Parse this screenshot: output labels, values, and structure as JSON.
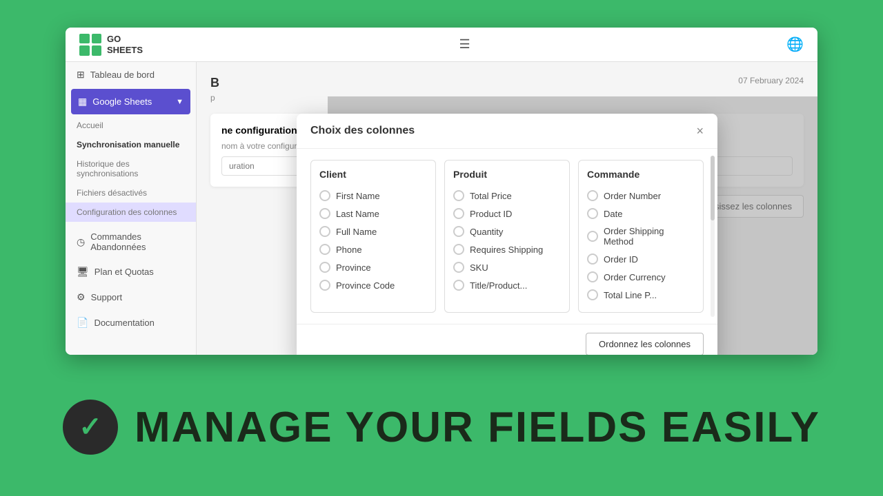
{
  "app": {
    "logo_name": "GO\nSHEETS",
    "date": "07 February 2024"
  },
  "sidebar": {
    "items": [
      {
        "label": "Tableau de bord",
        "icon": "⊞"
      },
      {
        "label": "Google Sheets",
        "icon": "▦",
        "active": true
      },
      {
        "label": "Accueil",
        "sub": true
      },
      {
        "label": "Synchronisation manuelle",
        "sub": true
      },
      {
        "label": "Historique des synchronisations",
        "sub": true
      },
      {
        "label": "Fichiers désactivés",
        "sub": true
      },
      {
        "label": "Configuration des colonnes",
        "sub": true,
        "selected": true
      },
      {
        "label": "Commandes Abandonnées",
        "icon": "◷"
      },
      {
        "label": "Plan et Quotas",
        "icon": "🖥"
      },
      {
        "label": "Support",
        "icon": "⚙"
      },
      {
        "label": "Documentation",
        "icon": "📄"
      }
    ]
  },
  "main": {
    "title": "B",
    "subtitle": "p",
    "date": "07 February 2024",
    "config": {
      "section_title": "ne configuration",
      "section_subtitle": "nom à votre configuration :",
      "input_placeholder": "uration",
      "choose_columns_label": "Choisissez les colonnes"
    }
  },
  "modal": {
    "title": "Choix des colonnes",
    "close_label": "×",
    "groups": [
      {
        "name": "client",
        "title": "Client",
        "items": [
          "First Name",
          "Last Name",
          "Full Name",
          "Phone",
          "Province",
          "Province Code"
        ]
      },
      {
        "name": "produit",
        "title": "Produit",
        "items": [
          "Total Price",
          "Product ID",
          "Quantity",
          "Requires Shipping",
          "SKU",
          "Title/Product..."
        ]
      },
      {
        "name": "commande",
        "title": "Commande",
        "items": [
          "Order Number",
          "Date",
          "Order Shipping Method",
          "Order ID",
          "Order Currency",
          "Total Line P..."
        ]
      }
    ],
    "footer_button": "Ordonnez les colonnes"
  },
  "banner": {
    "check_symbol": "✓",
    "text": "MANAGE YOUR FIELDS EASILY"
  }
}
